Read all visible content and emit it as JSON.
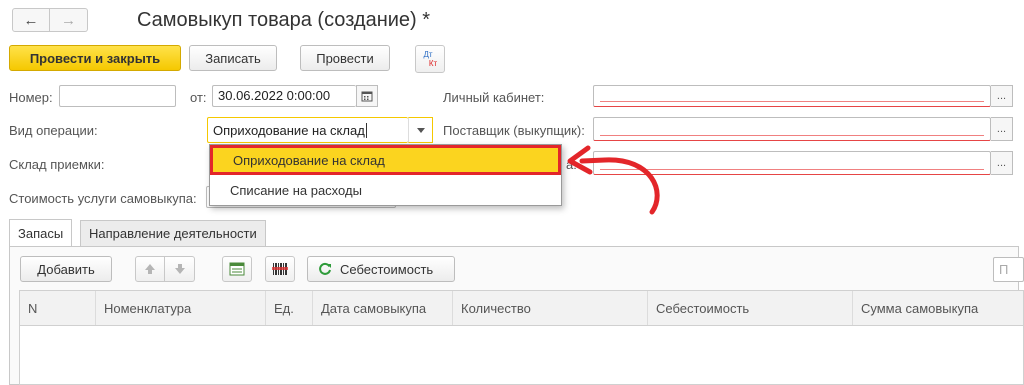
{
  "window": {
    "title": "Самовыкуп товара (создание) *",
    "nav_back": "←",
    "nav_forward": "→"
  },
  "toolbar": {
    "post_close_label": "Провести и закрыть",
    "save_label": "Записать",
    "post_label": "Провести",
    "dt_kt_top": "Дт",
    "dt_kt_bottom": "Кт"
  },
  "form": {
    "number_label": "Номер:",
    "number_value": "",
    "date_label": "от:",
    "date_value": "30.06.2022  0:00:00",
    "cabinet_label": "Личный кабинет:",
    "operation_label": "Вид операции:",
    "operation_value": "Оприходование на склад",
    "supplier_label": "Поставщик (выкупщик):",
    "warehouse_label": "Склад приемки:",
    "warehouse_right_partial": "а:",
    "cost_label": "Стоимость услуги самовыкупа:",
    "ellipsis": "..."
  },
  "dropdown": {
    "items": [
      "Оприходование на склад",
      "Списание на расходы"
    ]
  },
  "tabs": [
    "Запасы",
    "Направление деятельности"
  ],
  "table_toolbar": {
    "add_label": "Добавить",
    "cost_label": "Себестоимость",
    "search_partial": "П"
  },
  "table": {
    "columns": [
      "N",
      "Номенклатура",
      "Ед.",
      "Дата самовыкупа",
      "Количество",
      "Себестоимость",
      "Сумма самовыкупа"
    ]
  },
  "colors": {
    "accent_yellow": "#f5c800",
    "highlight_red": "#e3262a",
    "required_red": "#e64545"
  }
}
